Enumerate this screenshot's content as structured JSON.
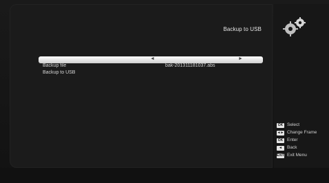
{
  "screen": {
    "title": "Backup to USB"
  },
  "menu": {
    "rows": [
      {
        "label": "",
        "value": "",
        "selected": true
      },
      {
        "label": "Backup file",
        "value": "bak-201311181037.abs"
      },
      {
        "label": "Backup to USB",
        "value": ""
      }
    ]
  },
  "legend": {
    "items": [
      {
        "key": "OK",
        "label": "Select"
      },
      {
        "key": "◄►",
        "label": "Change Frame"
      },
      {
        "key": "OK",
        "label": "Enter"
      },
      {
        "key": "◄",
        "label": "Back"
      },
      {
        "key": "EXIT",
        "label": "Exit Menu"
      }
    ]
  },
  "icons": {
    "settings": "gear-icon"
  },
  "colors": {
    "background": "#1b1b1b",
    "selection": "#ffffff",
    "text": "#d6d6d6"
  }
}
